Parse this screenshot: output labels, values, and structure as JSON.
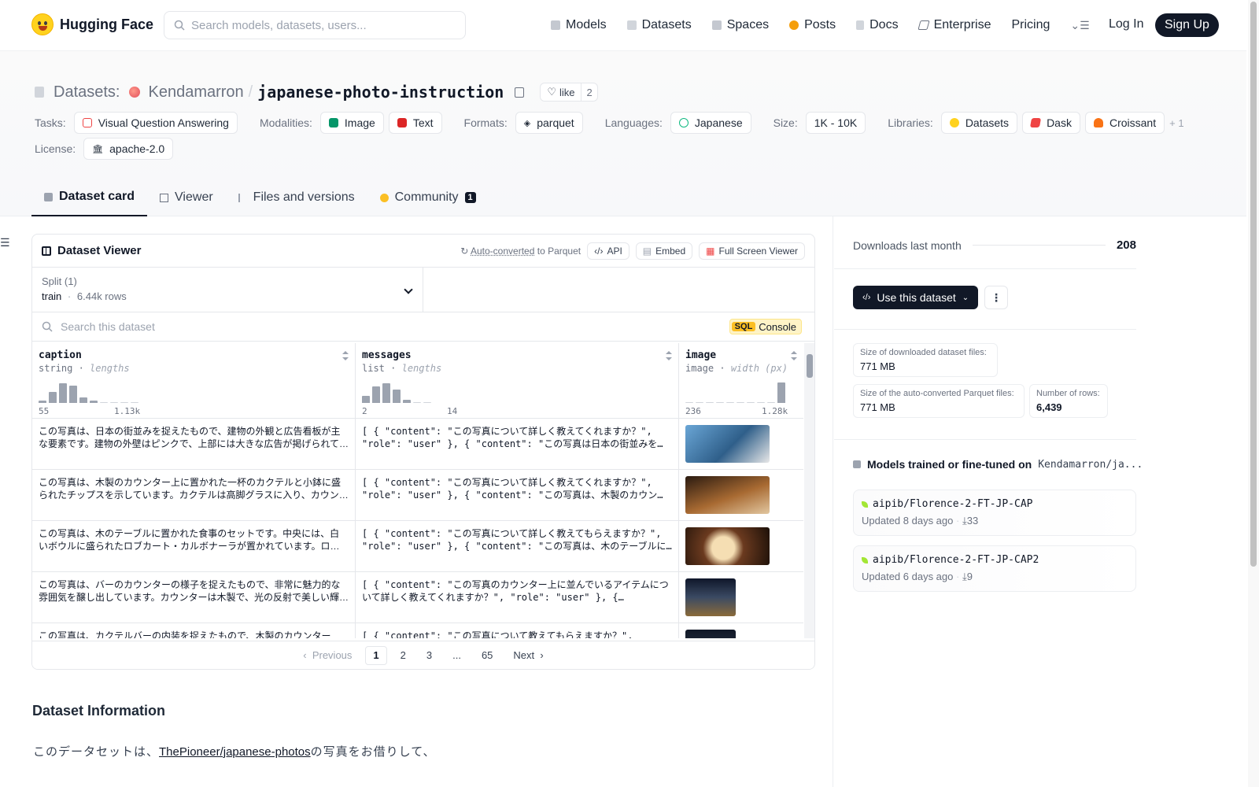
{
  "nav": {
    "brand": "Hugging Face",
    "search_placeholder": "Search models, datasets, users...",
    "links": [
      "Models",
      "Datasets",
      "Spaces",
      "Posts",
      "Docs",
      "Enterprise",
      "Pricing"
    ],
    "login": "Log In",
    "signup": "Sign Up"
  },
  "header": {
    "prefix": "Datasets:",
    "owner": "Kendamarron",
    "separator": "/",
    "repo": "japanese-photo-instruction",
    "like_label": "like",
    "like_count": "2",
    "tasks_label": "Tasks:",
    "task": "Visual Question Answering",
    "modalities_label": "Modalities:",
    "modality_1": "Image",
    "modality_2": "Text",
    "formats_label": "Formats:",
    "format": "parquet",
    "languages_label": "Languages:",
    "language": "Japanese",
    "size_label": "Size:",
    "size": "1K - 10K",
    "libraries_label": "Libraries:",
    "lib_1": "Datasets",
    "lib_2": "Dask",
    "lib_3": "Croissant",
    "lib_more": "+ 1",
    "license_label": "License:",
    "license": "apache-2.0"
  },
  "tabs": {
    "card": "Dataset card",
    "viewer": "Viewer",
    "files": "Files and versions",
    "community": "Community",
    "community_count": "1"
  },
  "viewer": {
    "title": "Dataset Viewer",
    "auto_converted": "Auto-converted",
    "to_parquet": "to Parquet",
    "api": "API",
    "embed": "Embed",
    "fullscreen": "Full Screen Viewer",
    "split_label": "Split (1)",
    "split_name": "train",
    "split_dot": "·",
    "split_rows": "6.44k rows",
    "search_placeholder": "Search this dataset",
    "sql": "SQL",
    "console": "Console",
    "columns": [
      {
        "name": "caption",
        "type": "string",
        "meta": "lengths",
        "min": "55",
        "max": "1.13k"
      },
      {
        "name": "messages",
        "type": "list",
        "meta": "lengths",
        "min": "2",
        "max": "14"
      },
      {
        "name": "image",
        "type": "image",
        "meta": "width (px)",
        "min": "236",
        "max": "1.28k"
      }
    ],
    "histograms": {
      "caption": [
        0.1,
        0.55,
        0.95,
        0.85,
        0.25,
        0.1,
        0.05,
        0.05,
        0.05,
        0.05
      ],
      "messages": [
        0.35,
        0.8,
        0.95,
        0.65,
        0.15,
        0.05,
        0.05
      ],
      "image": [
        0.05,
        0.05,
        0.05,
        0.05,
        0.05,
        0.05,
        0.05,
        0.05,
        0.05,
        1.0
      ]
    },
    "rows": [
      {
        "caption": "この写真は、日本の街並みを捉えたもので、建物の外観と広告看板が主な要素です。建物の外壁はピンクで、上部には大きな広告が掲げられています。",
        "messages": "[ { \"content\": \"この写真について詳しく教えてくれますか？\", \"role\": \"user\" }, { \"content\": \"この写真は日本の街並みを捉えたものです…",
        "thumb": "#3b82c4"
      },
      {
        "caption": "この写真は、木製のカウンター上に置かれた一杯のカクテルと小鉢に盛られたチップスを示しています。カクテルは高脚グラスに入り、カウンターの上…",
        "messages": "[ { \"content\": \"この写真について詳しく教えてくれますか？\", \"role\": \"user\" }, { \"content\": \"この写真は、木製のカウンター…",
        "thumb": "#8a5a2b"
      },
      {
        "caption": "この写真は、木のテーブルに置かれた食事のセットです。中央には、白いボウルに盛られたロブカート・カルボナーラが置かれています。ロブ…",
        "messages": "[ { \"content\": \"この写真について詳しく教えてもらえますか？\", \"role\": \"user\" }, { \"content\": \"この写真は、木のテーブルに…",
        "thumb": "#6b3a1f"
      },
      {
        "caption": "この写真は、バーのカウンターの様子を捉えたもので、非常に魅力的な雰囲気を醸し出しています。カウンターは木製で、光の反射で美しい輝…",
        "messages": "[ { \"content\": \"この写真のカウンター上に並んでいるアイテムについて詳しく教えてくれますか？\", \"role\": \"user\" }, {…",
        "thumb": "#2b2f3a"
      },
      {
        "caption": "この写真は、カクテルバーの内装を捉えたもので、木製のカウンターが…",
        "messages": "[ { \"content\": \"この写真について教えてもらえますか？\",",
        "thumb": "#1f2937"
      }
    ],
    "pager": {
      "prev": "Previous",
      "p1": "1",
      "p2": "2",
      "p3": "3",
      "ellipsis": "...",
      "last": "65",
      "next": "Next"
    }
  },
  "info": {
    "heading": "Dataset Information",
    "text_before": "このデータセットは、",
    "link": "ThePioneer/japanese-photos",
    "text_after": "の写真をお借りして、"
  },
  "sidebar": {
    "downloads_label": "Downloads last month",
    "downloads": "208",
    "use_button": "Use this dataset",
    "size_dl_label": "Size of downloaded dataset files:",
    "size_dl": "771 MB",
    "size_pq_label": "Size of the auto-converted Parquet files:",
    "size_pq": "771 MB",
    "rows_label": "Number of rows:",
    "rows": "6,439",
    "models_label": "Models trained or fine-tuned on",
    "models_tail": "Kendamarron/ja...",
    "models": [
      {
        "name": "aipib/Florence-2-FT-JP-CAP",
        "updated": "Updated 8 days ago",
        "downloads": "33"
      },
      {
        "name": "aipib/Florence-2-FT-JP-CAP2",
        "updated": "Updated 6 days ago",
        "downloads": "9"
      }
    ]
  },
  "colors": {
    "accent": "#111827",
    "hf_yellow": "#ffd21e",
    "sql_bg": "#fef3c7"
  }
}
